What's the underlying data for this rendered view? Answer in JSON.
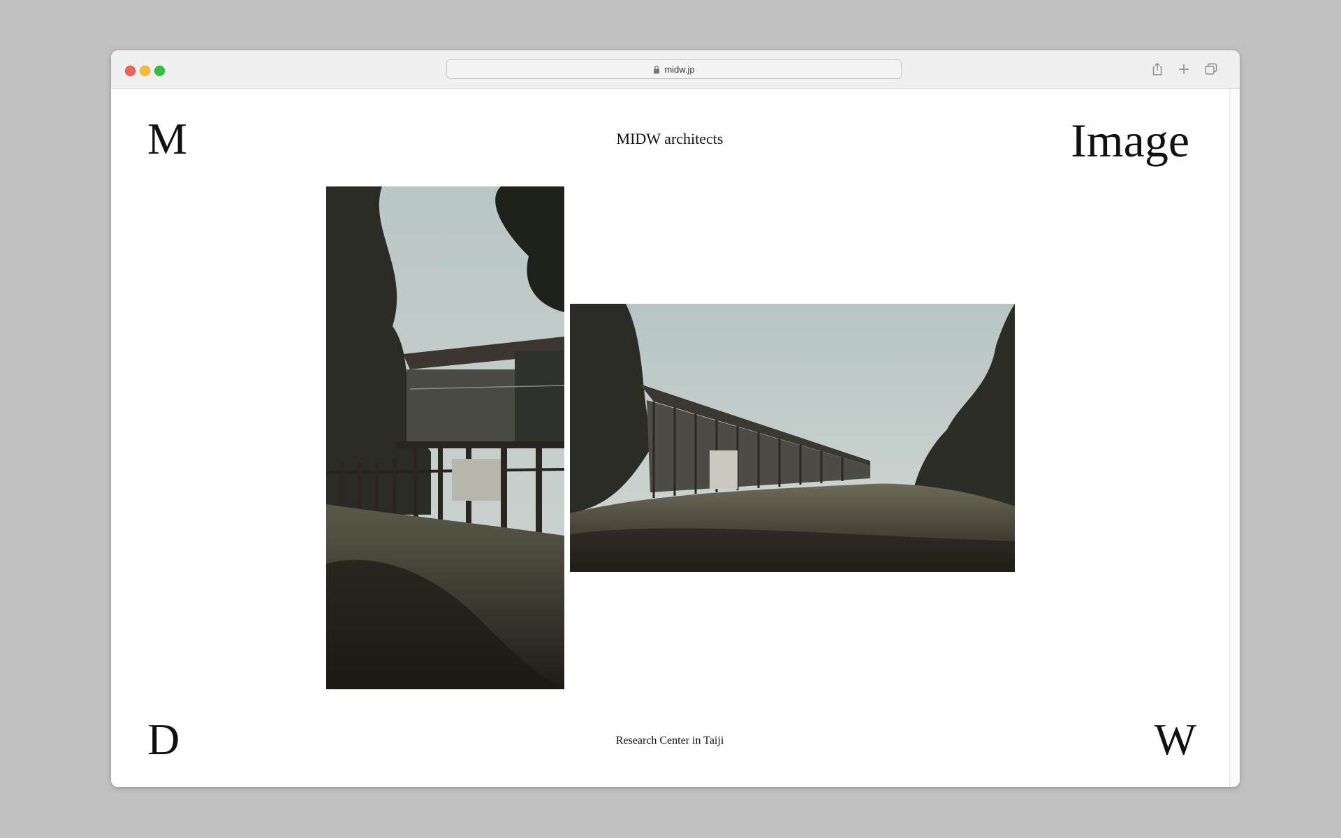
{
  "browser": {
    "url": "midw.jp",
    "icons": [
      "lock-icon",
      "share-icon",
      "new-tab-icon",
      "tab-overview-icon"
    ]
  },
  "page": {
    "corner_top_left": "M",
    "corner_top_right": "Image",
    "corner_bottom_left": "D",
    "corner_bottom_right": "W",
    "site_title": "MIDW architects",
    "caption": "Research Center in Taiji"
  },
  "colors": {
    "background": "#c0c0c0",
    "page": "#ffffff",
    "text": "#111111"
  }
}
